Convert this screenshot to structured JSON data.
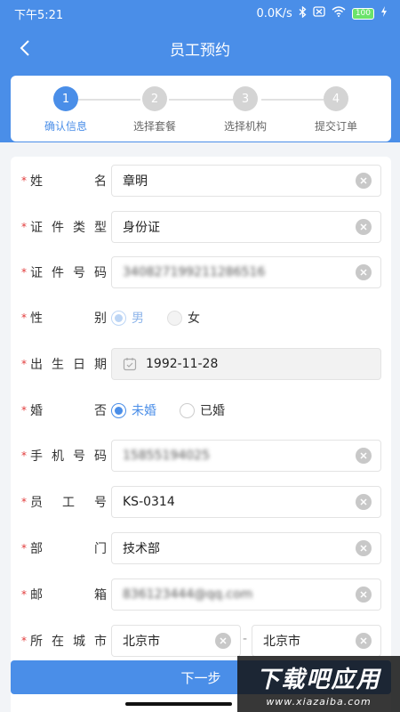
{
  "status_bar": {
    "time": "下午5:21",
    "network_speed": "0.0K/s",
    "battery": "100"
  },
  "nav": {
    "title": "员工预约"
  },
  "steps": [
    {
      "number": "1",
      "label": "确认信息",
      "active": true
    },
    {
      "number": "2",
      "label": "选择套餐",
      "active": false
    },
    {
      "number": "3",
      "label": "选择机构",
      "active": false
    },
    {
      "number": "4",
      "label": "提交订单",
      "active": false
    }
  ],
  "form": {
    "name": {
      "label": "姓名",
      "value": "章明"
    },
    "id_type": {
      "label": "证件类型",
      "value": "身份证"
    },
    "id_number": {
      "label": "证件号码",
      "value": "340827199211286516"
    },
    "gender": {
      "label": "性别",
      "options": [
        "男",
        "女"
      ],
      "selected": "男"
    },
    "birth_date": {
      "label": "出生日期",
      "value": "1992-11-28"
    },
    "marital": {
      "label": "婚否",
      "options": [
        "未婚",
        "已婚"
      ],
      "selected": "未婚"
    },
    "phone": {
      "label": "手机号码",
      "value": "15855194025"
    },
    "employee_no": {
      "label": "员工号",
      "value": "KS-0314"
    },
    "department": {
      "label": "部门",
      "value": "技术部"
    },
    "email": {
      "label": "邮箱",
      "value": "836123444@qq.com"
    },
    "city": {
      "label": "所在城市",
      "province": "北京市",
      "city": "北京市",
      "separator": "-"
    }
  },
  "actions": {
    "next_label": "下一步"
  },
  "watermark": {
    "line1": "下载吧应用",
    "line2": "www.xiazaiba.com"
  },
  "colors": {
    "accent": "#4a8ee8",
    "required": "#e23b3b"
  }
}
